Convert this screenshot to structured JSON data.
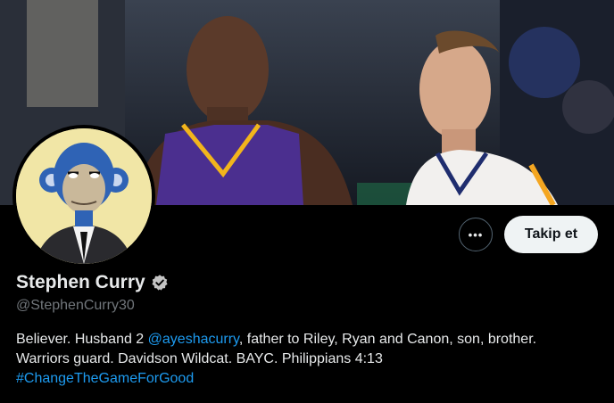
{
  "profile": {
    "display_name": "Stephen Curry",
    "handle": "@StephenCurry30",
    "verified_icon": "verified-badge-icon",
    "bio": {
      "line1_before": "Believer. Husband 2 ",
      "mention": "@ayeshacurry",
      "line1_after": ", father to Riley, Ryan and Canon, son, brother.",
      "line2": "Warriors guard. Davidson Wildcat. BAYC. Philippians 4:13",
      "hashtag": "#ChangeTheGameForGood"
    }
  },
  "actions": {
    "more_label": "•••",
    "follow_label": "Takip et"
  },
  "colors": {
    "background": "#000000",
    "link": "#1d9bf0",
    "secondary_text": "#71767b",
    "follow_button_bg": "#eff3f4",
    "verified_gray": "#c4c4c4",
    "avatar_bg": "#f1e6a6",
    "ape_blue": "#2f63b5"
  }
}
